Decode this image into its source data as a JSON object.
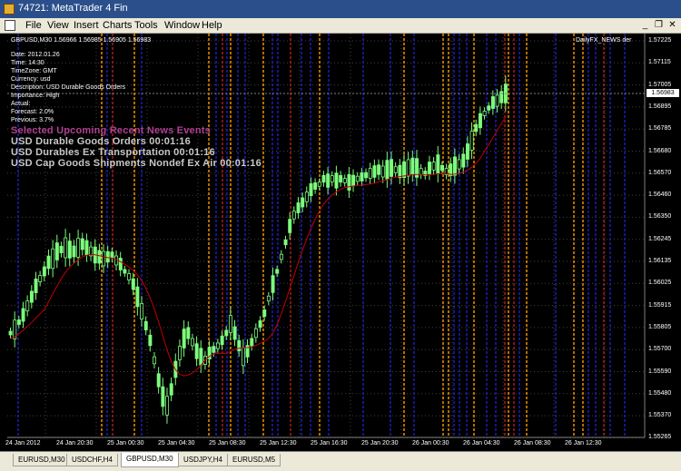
{
  "window": {
    "title": "74721: MetaTrader 4 Fin"
  },
  "menu": [
    "File",
    "View",
    "Insert",
    "Charts",
    "Tools",
    "Window",
    "Help"
  ],
  "window_controls": {
    "minimize": "_",
    "restore": "❐",
    "close": "✕"
  },
  "chart": {
    "symbol_line": "GBPUSD,M30  1.56966 1.56985 1.56905 1.56983",
    "indicator_label": "DailyFX_NEWS",
    "indicator_label2": "der",
    "current_price": "1.56983",
    "event_info": [
      "Date: 2012.01.26",
      "Time: 14:30",
      "TimeZone: GMT",
      "Currency: usd",
      "Description: USD Durable Goods Orders",
      "Importance: High",
      "Actual:",
      "Forecast: 2.0%",
      "Previous: 3.7%"
    ],
    "news_header": "Selected Upcoming Recent News Events",
    "news_items": [
      "USD Durable Goods Orders 00:01:16",
      "USD Durables Ex Transportation 00:01:16",
      "USD Cap Goods Shipments Nondef Ex Air 00:01:16"
    ],
    "price_axis": [
      "1.57225",
      "1.57115",
      "1.57005",
      "1.56895",
      "1.56785",
      "1.56680",
      "1.56570",
      "1.56460",
      "1.56350",
      "1.56245",
      "1.56135",
      "1.56025",
      "1.55915",
      "1.55805",
      "1.55700",
      "1.55590",
      "1.55480",
      "1.55370",
      "1.55265"
    ],
    "time_axis": [
      "24 Jan 2012",
      "24 Jan 20:30",
      "25 Jan 00:30",
      "25 Jan 04:30",
      "25 Jan 08:30",
      "25 Jan 12:30",
      "25 Jan 16:30",
      "25 Jan 20:30",
      "26 Jan 00:30",
      "26 Jan 04:30",
      "26 Jan 08:30",
      "26 Jan 12:30"
    ],
    "colors": {
      "bull": "#7cfc7c",
      "bear": "#7cfc7c",
      "ma": "#c00000",
      "grid": "#404040",
      "high_event": "#ff9900",
      "medium_event": "#2020c0",
      "low_event": "#b02020"
    }
  },
  "tabs": [
    "EURUSD,M30",
    "USDCHF,H4",
    "GBPUSD,M30",
    "USDJPY,H4",
    "EURUSD,M5"
  ],
  "active_tab": "GBPUSD,M30"
}
